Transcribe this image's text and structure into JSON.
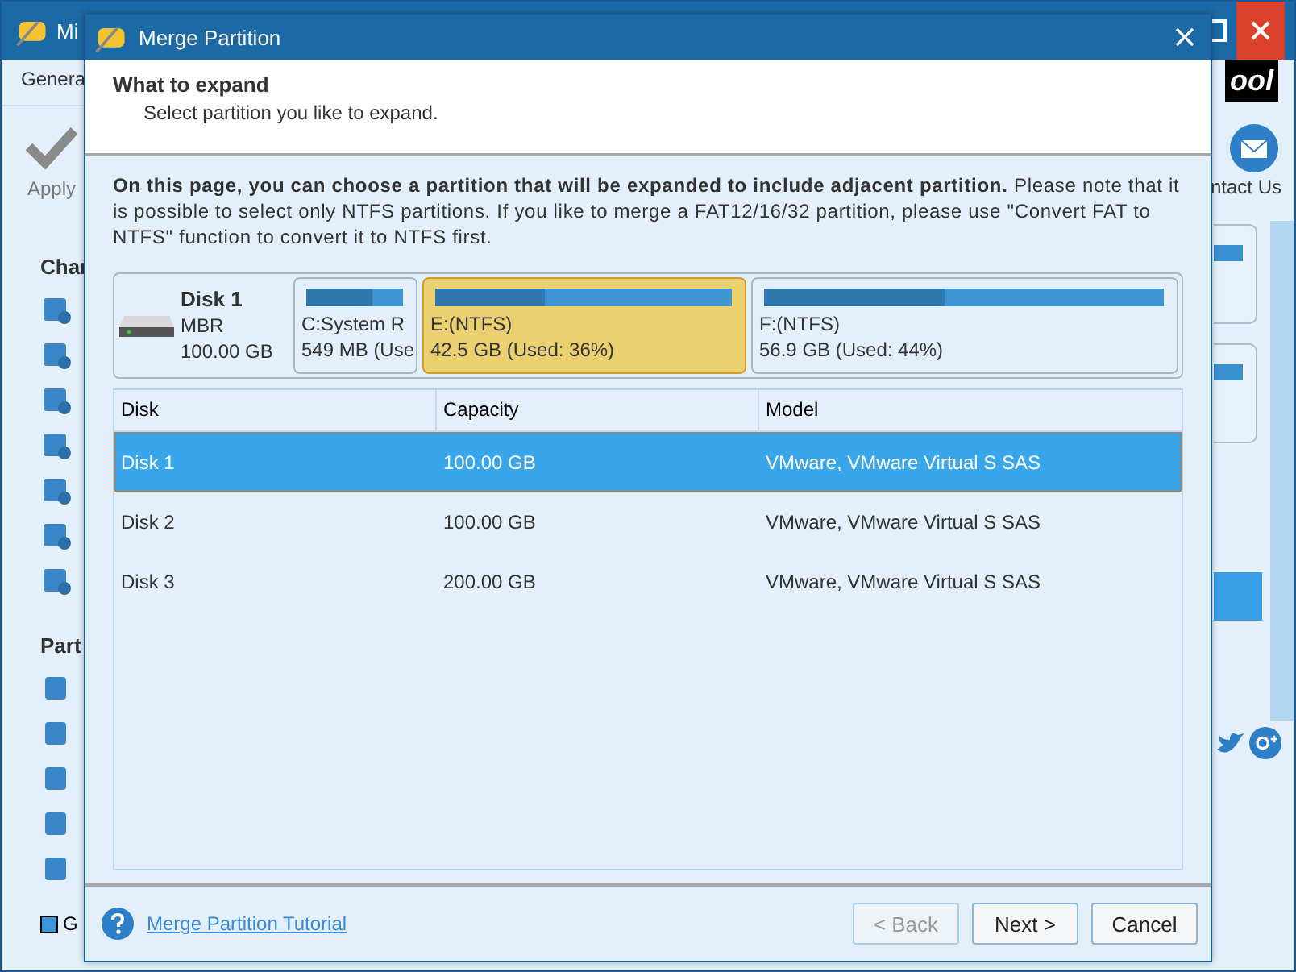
{
  "app": {
    "title": "Mi",
    "menu_tab": "Genera",
    "apply_label": "Apply",
    "section_1": "Char",
    "section_2": "Part",
    "legend": "G",
    "logo": "ool",
    "contact_label": "ntact Us"
  },
  "dialog": {
    "title": "Merge Partition",
    "header": {
      "title": "What to expand",
      "subtitle": "Select partition you like to expand."
    },
    "description": "**On this page, you can choose a partition that will be expanded to include adjacent partition.** Please note that it is possible to select only NTFS partitions. If you like to merge a FAT12/16/32 partition, please use \"Convert FAT to NTFS\" function to convert it to NTFS first.",
    "disk_map": {
      "disk": {
        "name": "Disk 1",
        "type": "MBR",
        "size": "100.00 GB"
      },
      "partitions": [
        {
          "name": "C:System R",
          "size": "549 MB (Use",
          "level": 0.68,
          "selected": false
        },
        {
          "name": "E:(NTFS)",
          "size": "42.5 GB (Used: 36%)",
          "level": 0.37,
          "selected": true
        },
        {
          "name": "F:(NTFS)",
          "size": "56.9 GB (Used: 44%)",
          "level": 0.45,
          "selected": false
        }
      ]
    },
    "table": {
      "columns": [
        "Disk",
        "Capacity",
        "Model"
      ],
      "rows": [
        {
          "cells": [
            "Disk 1",
            "100.00 GB",
            "VMware, VMware Virtual S SAS"
          ],
          "selected": true
        },
        {
          "cells": [
            "Disk 2",
            "100.00 GB",
            "VMware, VMware Virtual S SAS"
          ],
          "selected": false
        },
        {
          "cells": [
            "Disk 3",
            "200.00 GB",
            "VMware, VMware Virtual S SAS"
          ],
          "selected": false
        }
      ]
    },
    "tutorial_link": "Merge Partition Tutorial",
    "buttons": [
      {
        "label": "< Back",
        "disabled": true
      },
      {
        "label": "Next >",
        "disabled": false
      },
      {
        "label": "Cancel",
        "disabled": false
      }
    ]
  }
}
